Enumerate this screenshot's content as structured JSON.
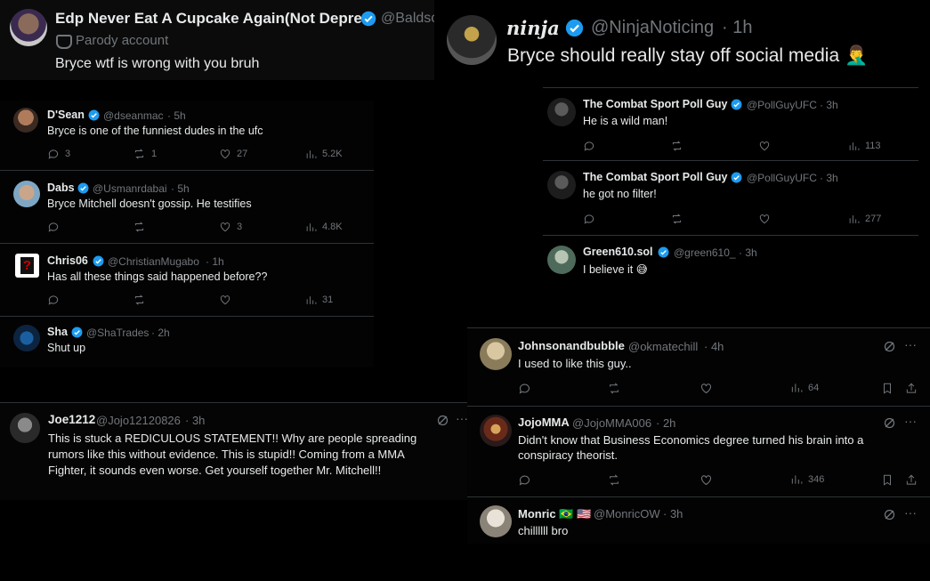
{
  "post_top_left": {
    "name": "Edp Never Eat A Cupcake Again(Not Depre...",
    "handle": "@Baldsc",
    "badge_label": "Parody account",
    "text": "Bryce wtf is wrong with you bruh"
  },
  "post_top_right": {
    "name": "ninja",
    "handle": "@NinjaNoticing",
    "time": "· 1h",
    "text": "Bryce should really stay off social media 🤦‍♂️"
  },
  "left_replies": [
    {
      "name": "D'Sean",
      "handle": "@dseanmac",
      "time": "· 5h",
      "text": "Bryce is one of the funniest dudes in the ufc",
      "replies": "3",
      "reposts": "1",
      "likes": "27",
      "views": "5.2K"
    },
    {
      "name": "Dabs",
      "handle": "@Usmanrdabai",
      "time": "· 5h",
      "text": "Bryce Mitchell doesn't gossip. He testifies",
      "replies": "",
      "reposts": "",
      "likes": "3",
      "views": "4.8K"
    },
    {
      "name": "Chris06",
      "handle": "@ChristianMugabo",
      "time": "· 1h",
      "text": "Has all these things said happened before??",
      "replies": "",
      "reposts": "",
      "likes": "",
      "views": "31"
    },
    {
      "name": "Sha",
      "handle": "@ShaTrades",
      "time": "· 2h",
      "text": "Shut up"
    }
  ],
  "right_replies": [
    {
      "name": "The Combat Sport Poll Guy",
      "handle": "@PollGuyUFC",
      "time": "· 3h",
      "text": "He is a wild man!",
      "views": "113"
    },
    {
      "name": "The Combat Sport Poll Guy",
      "handle": "@PollGuyUFC",
      "time": "· 3h",
      "text": "he got no filter!",
      "views": "277"
    },
    {
      "name": "Green610.sol",
      "handle": "@green610_",
      "time": "· 3h",
      "text": "I believe it 😅"
    }
  ],
  "joe_post": {
    "name": "Joe1212",
    "handle": "@Jojo12120826",
    "time": "· 3h",
    "lines": [
      "This is stuck a REDICULOUS STATEMENT!!  Why are people spreading",
      "rumors like this without evidence. This is stupid!! Coming from a MMA",
      "Fighter, it sounds even worse. Get yourself together Mr. Mitchell!!"
    ],
    "more": "···"
  },
  "bottom_right": [
    {
      "name": "Johnsonandbubble",
      "handle": "@okmatechill",
      "time": "· 4h",
      "lines": [
        "I used to like this guy.."
      ],
      "views": "64"
    },
    {
      "name": "JojoMMA",
      "handle": "@JojoMMA006",
      "time": "· 2h",
      "lines": [
        "Didn't know that Business Economics degree turned his brain into a",
        "conspiracy theorist."
      ],
      "views": "346"
    },
    {
      "name": "Monric 🇧🇷 🇺🇸",
      "handle": "@MonricOW",
      "time": "· 3h",
      "lines": [
        "chillllll bro"
      ]
    }
  ],
  "more_label": "···",
  "colors": {
    "verified": "#1d9bf0",
    "muted": "#71767b",
    "text": "#e7e9ea",
    "divider": "#2f3336"
  },
  "icons": [
    "reply-icon",
    "repost-icon",
    "like-icon",
    "views-icon",
    "bookmark-icon",
    "share-icon",
    "grok-icon",
    "more-icon",
    "verified-icon",
    "parody-mask-icon"
  ]
}
